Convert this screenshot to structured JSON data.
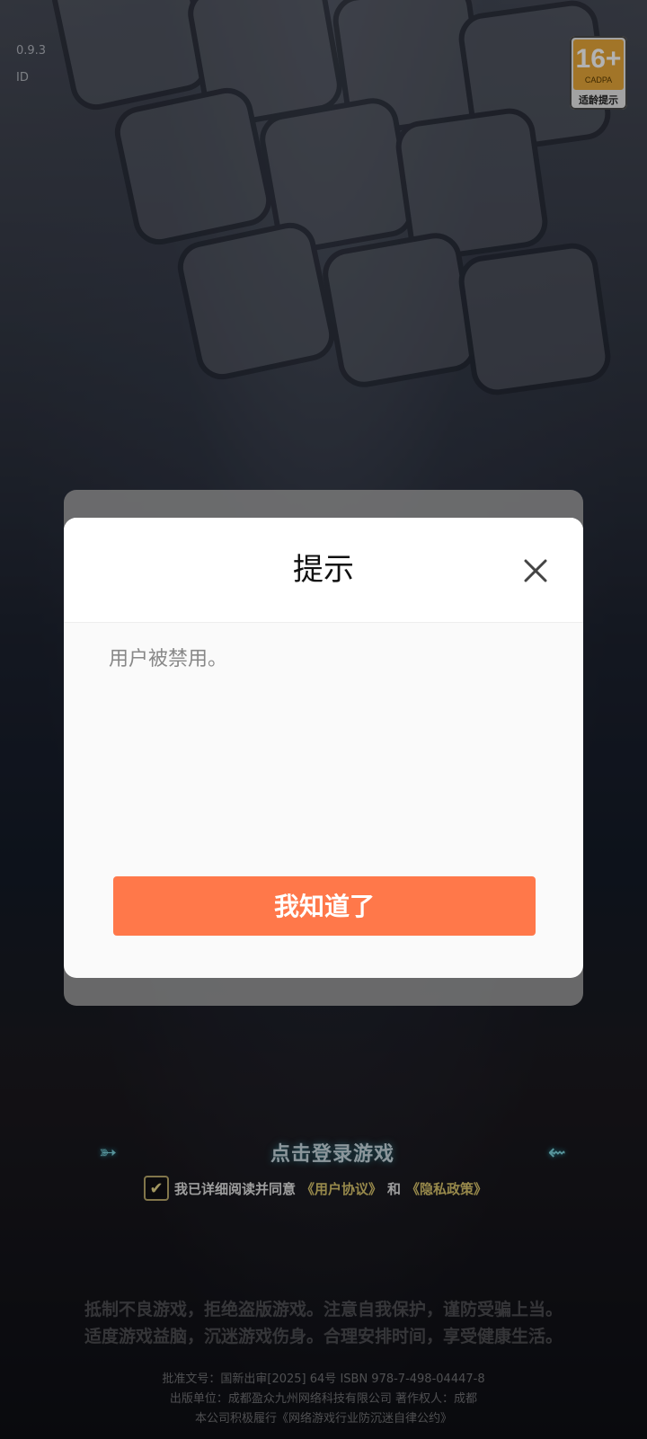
{
  "status": {
    "version": "0.9.3",
    "id_label": "ID"
  },
  "age_rating": {
    "age": "16+",
    "org": "CADPA",
    "label": "适龄提示",
    "color": "#e8a83a"
  },
  "login": {
    "prompt": "点击登录游戏",
    "agree_prefix": "我已详细阅读并同意",
    "user_agreement": "《用户协议》",
    "conjunction": "和",
    "privacy_policy": "《隐私政策》"
  },
  "health_notice": {
    "line1": "抵制不良游戏，拒绝盗版游戏。注意自我保护，谨防受骗上当。",
    "line2": "适度游戏益脑，沉迷游戏伤身。合理安排时间，享受健康生活。"
  },
  "legal": {
    "line1": "批准文号：国新出审[2025] 64号 ISBN 978-7-498-04447-8",
    "line2": "出版单位：成都盈众九州网络科技有限公司 著作权人：成都",
    "line3": "本公司积极履行《网络游戏行业防沉迷自律公约》"
  },
  "dialog": {
    "title": "提示",
    "message": "用户被禁用。",
    "confirm_label": "我知道了",
    "accent": "#ff784a"
  }
}
